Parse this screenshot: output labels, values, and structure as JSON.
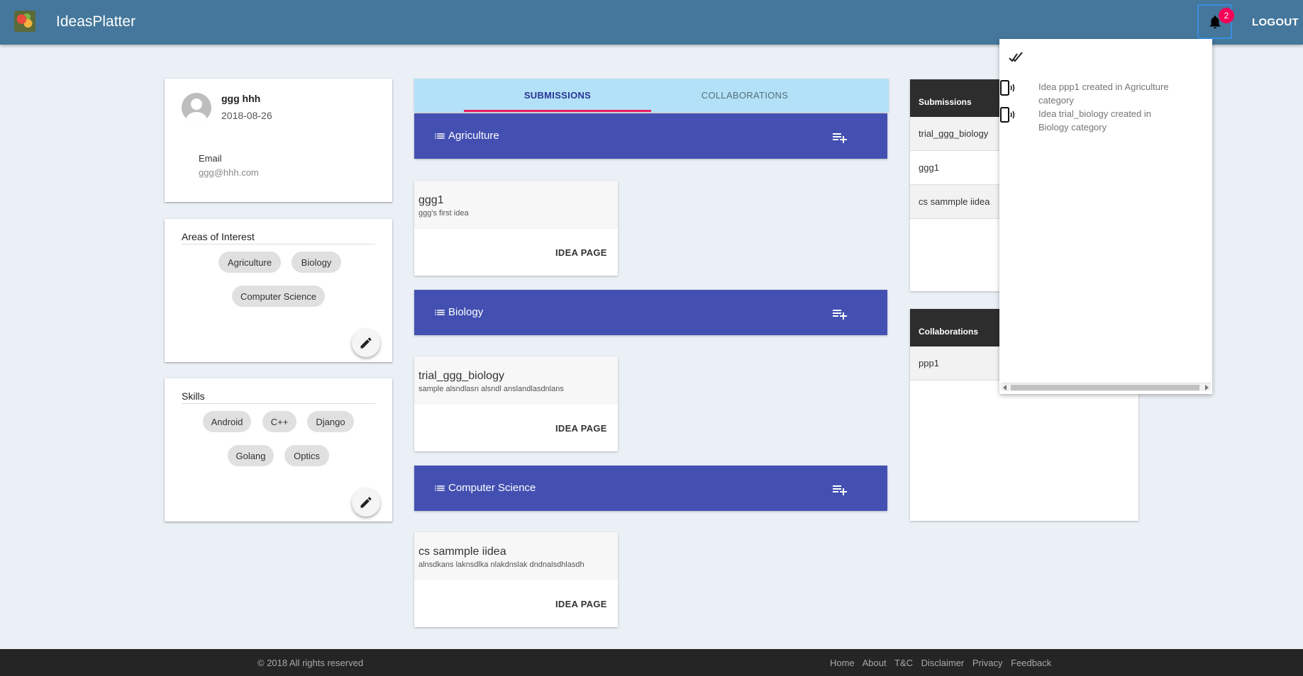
{
  "header": {
    "brand": "IdeasPlatter",
    "notification_count": "2",
    "logout_label": "LOGOUT",
    "bar_color": "#44779b"
  },
  "profile": {
    "name": "ggg hhh",
    "date": "2018-08-26",
    "email_label": "Email",
    "email": "ggg@hhh.com"
  },
  "interests": {
    "title": "Areas of Interest",
    "chips": [
      "Agriculture",
      "Biology",
      "Computer Science"
    ]
  },
  "skills": {
    "title": "Skills",
    "chips": [
      "Android",
      "C++",
      "Django",
      "Golang",
      "Optics"
    ]
  },
  "tabs": {
    "submissions": "SUBMISSIONS",
    "collaborations": "COLLABORATIONS",
    "active": "SUBMISSIONS"
  },
  "categories": [
    {
      "name": "Agriculture",
      "idea": {
        "title": "ggg1",
        "description": "ggg's first idea",
        "button": "IDEA PAGE"
      }
    },
    {
      "name": "Biology",
      "idea": {
        "title": "trial_ggg_biology",
        "description": "sample alsndlasn alsndl anslandlasdnlans",
        "button": "IDEA PAGE"
      }
    },
    {
      "name": "Computer Science",
      "idea": {
        "title": "cs sammple iidea",
        "description": "alnsdkans laknsdlka nlakdnslak dndnalsdhlasdh",
        "button": "IDEA PAGE"
      }
    }
  ],
  "side_submissions": {
    "title": "Submissions",
    "items": [
      "trial_ggg_biology",
      "ggg1",
      "cs sammple iidea"
    ]
  },
  "side_collaborations": {
    "title": "Collaborations",
    "items": [
      "ppp1"
    ]
  },
  "notifications": {
    "items": [
      "Idea ppp1 created in Agriculture category",
      "Idea trial_biology created in Biology category"
    ]
  },
  "footer": {
    "copyright": "© 2018 All rights reserved",
    "links": [
      "Home",
      "About",
      "T&C",
      "Disclaimer",
      "Privacy",
      "Feedback"
    ]
  },
  "colors": {
    "category_bar": "#4350b1",
    "tab_bg": "#b3e1f7",
    "tab_indicator": "#e91e63",
    "badge": "#f50057"
  }
}
